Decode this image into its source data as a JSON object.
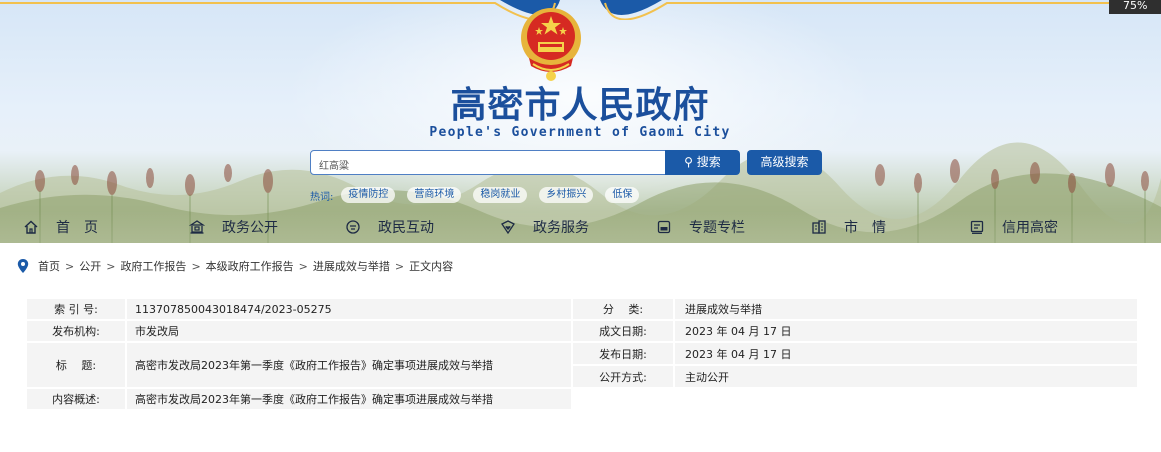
{
  "overlay": {
    "zoom": "75%"
  },
  "site": {
    "title": "高密市人民政府",
    "subtitle": "People's Government of Gaomi City"
  },
  "search": {
    "value": "红高粱",
    "button_label": "搜索",
    "advanced_label": "高级搜索",
    "hot_label": "热词:",
    "hot_tags": [
      "疫情防控",
      "营商环境",
      "稳岗就业",
      "乡村振兴",
      "低保"
    ]
  },
  "nav": {
    "items": [
      {
        "label": "首　页",
        "icon": "home-icon"
      },
      {
        "label": "政务公开",
        "icon": "building-icon"
      },
      {
        "label": "政民互动",
        "icon": "chat-icon"
      },
      {
        "label": "政务服务",
        "icon": "shield-heart-icon"
      },
      {
        "label": "专题专栏",
        "icon": "folder-icon"
      },
      {
        "label": "市　情",
        "icon": "city-icon"
      },
      {
        "label": "信用高密",
        "icon": "credit-icon"
      }
    ]
  },
  "breadcrumb": {
    "items": [
      "首页",
      "公开",
      "政府工作报告",
      "本级政府工作报告",
      "进展成效与举措",
      "正文内容"
    ],
    "separator": ">"
  },
  "meta": {
    "index_label": "索 引 号:",
    "index_value": "113707850043018474/2023-05275",
    "category_label": "分　 类:",
    "category_value": "进展成效与举措",
    "publisher_label": "发布机构:",
    "publisher_value": "市发改局",
    "created_label": "成文日期:",
    "created_value": "2023 年 04 月 17 日",
    "title_label": "标　 题:",
    "title_value": "高密市发改局2023年第一季度《政府工作报告》确定事项进展成效与举措",
    "published_label": "发布日期:",
    "published_value": "2023 年 04 月 17 日",
    "method_label": "公开方式:",
    "method_value": "主动公开",
    "summary_label": "内容概述:",
    "summary_value": "高密市发改局2023年第一季度《政府工作报告》确定事项进展成效与举措"
  },
  "colors": {
    "brand_blue": "#1b5aa8",
    "title_blue": "#1b4f9c"
  }
}
